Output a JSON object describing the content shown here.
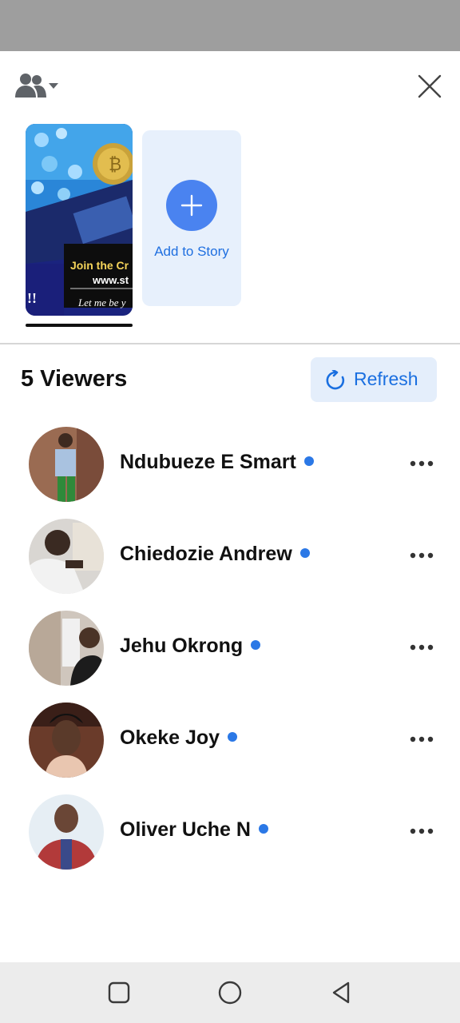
{
  "story": {
    "thumb_text_1": "Join the Cr",
    "thumb_text_2": "www.st",
    "thumb_text_3": "Let me be y",
    "thumb_text_4": "!!",
    "add_label": "Add to Story"
  },
  "viewers": {
    "title": "5 Viewers",
    "refresh_label": "Refresh",
    "list": [
      {
        "name": "Ndubueze E Smart",
        "skin": "#6b4a3a",
        "bg": "#9a6b52",
        "shirt": "#a9c2e0"
      },
      {
        "name": "Chiedozie Andrew",
        "skin": "#3a2a22",
        "bg": "#d9d6d2",
        "shirt": "#f2f2f2"
      },
      {
        "name": "Jehu Okrong",
        "skin": "#4a3326",
        "bg": "#cfc6bd",
        "shirt": "#1c1c1c"
      },
      {
        "name": "Okeke Joy",
        "skin": "#5a3a2a",
        "bg": "#6a3b2a",
        "shirt": "#e9c6b0"
      },
      {
        "name": "Oliver Uche N",
        "skin": "#6a4636",
        "bg": "#e6eef4",
        "shirt": "#b23a3a"
      }
    ]
  },
  "colors": {
    "accent": "#1f6fe0",
    "online_dot": "#2b78e6",
    "add_circle": "#4a83f0"
  },
  "icons": {
    "audience": "people-icon",
    "close": "close-icon",
    "refresh": "refresh-icon",
    "more": "more-options-icon",
    "nav_recent": "square-icon",
    "nav_home": "circle-icon",
    "nav_back": "triangle-back-icon"
  }
}
